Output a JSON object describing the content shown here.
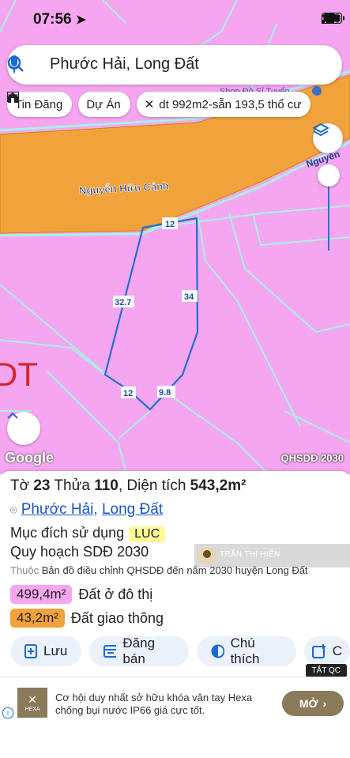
{
  "status_bar": {
    "time": "07:56"
  },
  "search": {
    "query": "Phước Hải, Long Đất"
  },
  "chips": [
    {
      "label": "Tin Đăng",
      "icon": "list-icon"
    },
    {
      "label": "Dự Án",
      "icon": "building-icon"
    },
    {
      "label": "dt 992m2-sẵn 193,5 thổ cư",
      "icon": "crossed-tools-icon"
    }
  ],
  "map": {
    "road_name": "Nguyễn Hữu Cảnh",
    "road_name_right": "Nguyễn",
    "shop_label": "Shop Đồ Sỉ Tuyển",
    "zone_label": "DT",
    "edge_labels": [
      "12",
      "32.7",
      "34",
      "12",
      "9.8"
    ],
    "attribution": "Google",
    "layer_label": "QHSDĐ 2030",
    "colors": {
      "land": "#f6a6f0",
      "road": "#f2a23a",
      "boundary": "#9ef0e0",
      "parcel": "#1f6fd6"
    }
  },
  "parcel": {
    "sheet_prefix": "Tờ",
    "sheet": "23",
    "lot_prefix": "Thửa",
    "lot": "110",
    "area_prefix": "Diện tích",
    "area": "543,2m²",
    "ward": "Phước Hải",
    "district": "Long Đất",
    "purpose_label": "Mục đích sử dụng",
    "purpose_code": "LUC",
    "plan_label": "Quy hoạch SDĐ 2030",
    "source_prefix": "Thuộc",
    "source_text": "Bản đồ điều chỉnh QHSDĐ đến năm 2030 huyện Long Đất",
    "owner_overlay": "TRẦN THỊ HIỀN",
    "allocations": [
      {
        "area": "499,4m²",
        "label": "Đất ở đô thị",
        "color": "#f6a6f0"
      },
      {
        "area": "43,2m²",
        "label": "Đất giao thông",
        "color": "#f2a23a"
      }
    ]
  },
  "actions": [
    {
      "label": "Lưu",
      "icon": "save-plus-icon"
    },
    {
      "label": "Đăng bán",
      "icon": "list-card-icon"
    },
    {
      "label": "Chú thích",
      "icon": "half-circle-icon"
    },
    {
      "label": "C",
      "icon": "photo-plus-icon"
    }
  ],
  "ad": {
    "close_label": "TẮT QC",
    "brand": "HEXA",
    "text": "Cơ hội duy nhất sở hữu khóa vân tay Hexa chống bụi nước IP66 giá cực tốt.",
    "cta": "MỞ"
  }
}
